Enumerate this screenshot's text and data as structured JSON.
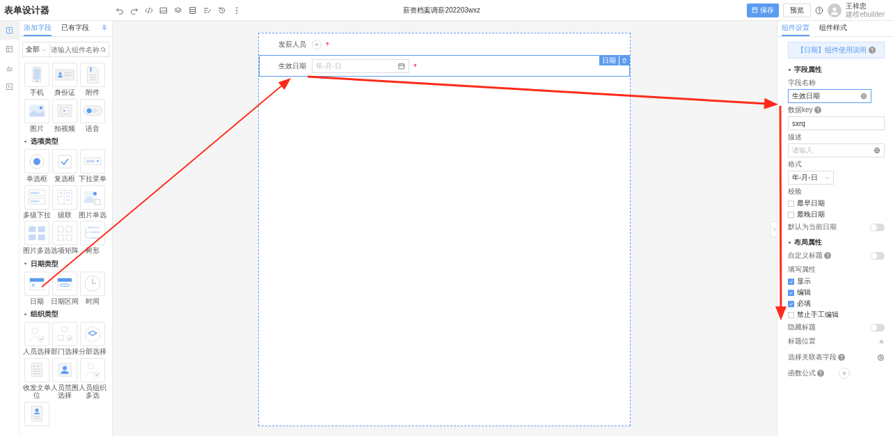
{
  "app_title": "表单设计器",
  "form_title": "薪资档案调薪202203wxz",
  "header": {
    "save": "保存",
    "preview": "预览",
    "user_name": "王祥忠",
    "user_org": "建模ebuilder"
  },
  "rail": [
    {
      "kind": "form",
      "selected": true
    },
    {
      "kind": "layout",
      "selected": false
    },
    {
      "kind": "chart",
      "selected": false
    },
    {
      "kind": "text",
      "selected": false
    }
  ],
  "field_panel": {
    "tabs": [
      {
        "label": "添加字段",
        "selected": true
      },
      {
        "label": "已有字段",
        "selected": false
      }
    ],
    "category": "全部",
    "search_placeholder": "请输入组件名称",
    "groups": [
      {
        "items": [
          {
            "label": "手机",
            "kind": "phone"
          },
          {
            "label": "身份证",
            "kind": "idcard"
          },
          {
            "label": "附件",
            "kind": "attachment"
          },
          {
            "label": "图片",
            "kind": "image"
          },
          {
            "label": "拍视频",
            "kind": "video"
          },
          {
            "label": "语音",
            "kind": "voice"
          }
        ]
      },
      {
        "title": "选项类型",
        "items": [
          {
            "label": "单选框",
            "kind": "radio"
          },
          {
            "label": "复选框",
            "kind": "checkbox"
          },
          {
            "label": "下拉菜单",
            "kind": "dropdown"
          },
          {
            "label": "多级下拉",
            "kind": "multidropdown"
          },
          {
            "label": "级联",
            "kind": "cascade"
          },
          {
            "label": "图片单选",
            "kind": "imageradio"
          },
          {
            "label": "图片多选",
            "kind": "imagemulti"
          },
          {
            "label": "选项矩阵",
            "kind": "matrix"
          },
          {
            "label": "树形",
            "kind": "tree"
          }
        ]
      },
      {
        "title": "日期类型",
        "items": [
          {
            "label": "日期",
            "kind": "date"
          },
          {
            "label": "日期区间",
            "kind": "daterange"
          },
          {
            "label": "时间",
            "kind": "time"
          }
        ]
      },
      {
        "title": "组织类型",
        "items": [
          {
            "label": "人员选择",
            "kind": "person"
          },
          {
            "label": "部门选择",
            "kind": "department"
          },
          {
            "label": "分部选择",
            "kind": "branch"
          },
          {
            "label": "收发文单位",
            "kind": "document"
          },
          {
            "label": "人员范围选择",
            "kind": "personrange"
          },
          {
            "label": "人员组织多选",
            "kind": "person"
          },
          {
            "kind": "profile"
          }
        ]
      }
    ]
  },
  "canvas": {
    "fields": [
      {
        "label": "发薪人员",
        "kind": "person",
        "required": true,
        "selected": false
      },
      {
        "label": "生效日期",
        "kind": "date",
        "placeholder": "年-月-日",
        "required": true,
        "selected": true,
        "tag": "日期"
      }
    ]
  },
  "settings_panel": {
    "tabs": [
      {
        "label": "组件设置",
        "selected": true
      },
      {
        "label": "组件样式",
        "selected": false
      }
    ],
    "help_banner": "【日期】组件使用说明",
    "items": [
      {
        "kind": "section",
        "label": "字段属性"
      },
      {
        "kind": "input",
        "label": "字段名称",
        "value": "生效日期",
        "focused": true,
        "globe": true
      },
      {
        "kind": "input",
        "label": "数据key",
        "help": true,
        "value": "sxrq",
        "focused": false
      },
      {
        "kind": "input",
        "label": "描述",
        "placeholder": "请输入",
        "focused": false,
        "globe": true
      },
      {
        "kind": "select",
        "label": "格式",
        "value": "年-月-日"
      },
      {
        "kind": "label",
        "label": "校验"
      },
      {
        "kind": "checkbox",
        "label": "最早日期",
        "checked": false
      },
      {
        "kind": "checkbox",
        "label": "最晚日期",
        "checked": false
      },
      {
        "kind": "toggle",
        "label": "默认为当前日期",
        "on": false
      },
      {
        "kind": "section",
        "label": "布局属性"
      },
      {
        "kind": "toggle",
        "label": "自定义标题",
        "help": true,
        "on": false
      },
      {
        "kind": "label",
        "label": "填写属性"
      },
      {
        "kind": "checkbox",
        "label": "显示",
        "checked": true
      },
      {
        "kind": "checkbox",
        "label": "编辑",
        "checked": true
      },
      {
        "kind": "checkbox",
        "label": "必填",
        "checked": true
      },
      {
        "kind": "checkbox",
        "label": "禁止手工编辑",
        "checked": false
      },
      {
        "kind": "toggle",
        "label": "隐藏标题",
        "on": false
      },
      {
        "kind": "collapse",
        "label": "标题位置"
      },
      {
        "kind": "gear",
        "label": "选择关联表字段",
        "help": true
      },
      {
        "kind": "add",
        "label": "函数公式",
        "help": true
      }
    ]
  }
}
